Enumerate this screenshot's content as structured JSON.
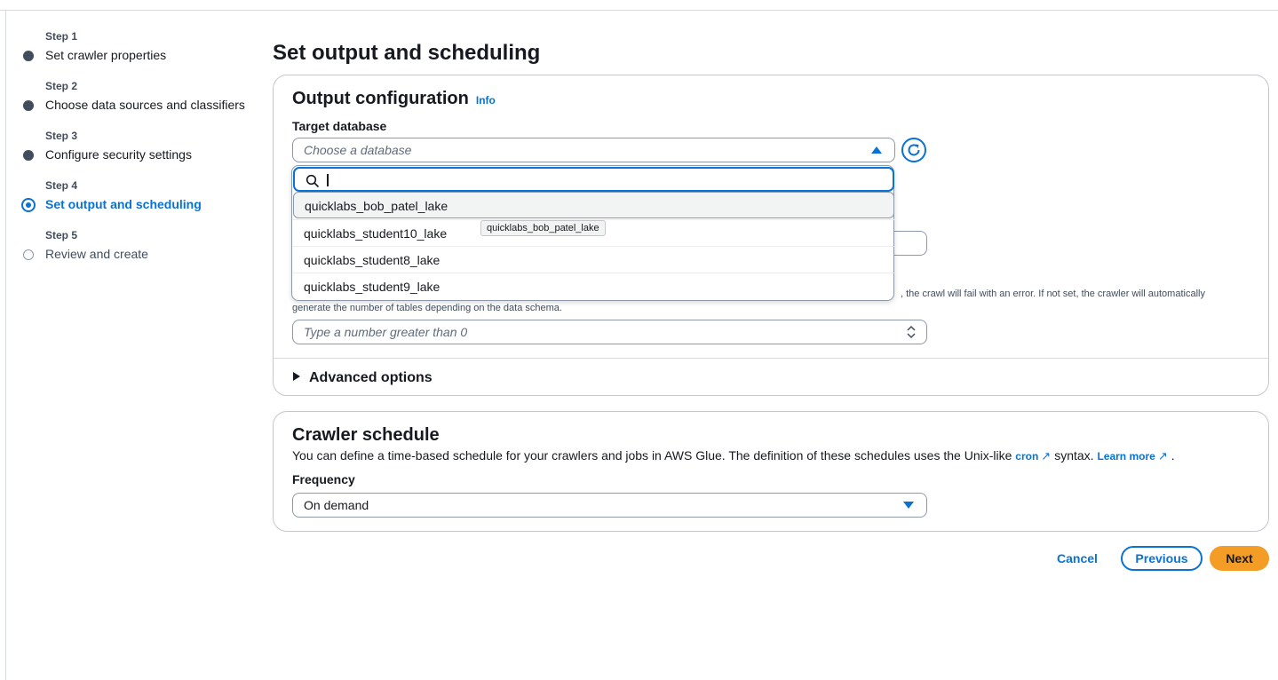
{
  "steps": [
    {
      "num": "Step 1",
      "label": "Set crawler properties"
    },
    {
      "num": "Step 2",
      "label": "Choose data sources and classifiers"
    },
    {
      "num": "Step 3",
      "label": "Configure security settings"
    },
    {
      "num": "Step 4",
      "label": "Set output and scheduling"
    },
    {
      "num": "Step 5",
      "label": "Review and create"
    }
  ],
  "page_title": "Set output and scheduling",
  "output": {
    "title": "Output configuration",
    "info": "Info",
    "target_db_label": "Target database",
    "target_db_placeholder": "Choose a database",
    "partial_desc_1": ", the crawl will fail with an error. If not set, the crawler will automatically",
    "partial_desc_2": "generate the number of tables depending on the data schema.",
    "max_tables_placeholder": "Type a number greater than 0",
    "advanced": "Advanced options"
  },
  "dropdown": {
    "options": [
      "quicklabs_bob_patel_lake",
      "quicklabs_student10_lake",
      "quicklabs_student8_lake",
      "quicklabs_student9_lake"
    ],
    "tooltip": "quicklabs_bob_patel_lake"
  },
  "schedule": {
    "title": "Crawler schedule",
    "desc_before": "You can define a time-based schedule for your crawlers and jobs in AWS Glue. The definition of these schedules uses the Unix-like",
    "cron": "cron",
    "desc_after": "syntax.",
    "learn_more": "Learn more",
    "period": ".",
    "frequency_label": "Frequency",
    "frequency_value": "On demand"
  },
  "buttons": {
    "cancel": "Cancel",
    "previous": "Previous",
    "next": "Next"
  },
  "colors": {
    "accent": "#0972d3",
    "primary_button": "#f39c26"
  }
}
